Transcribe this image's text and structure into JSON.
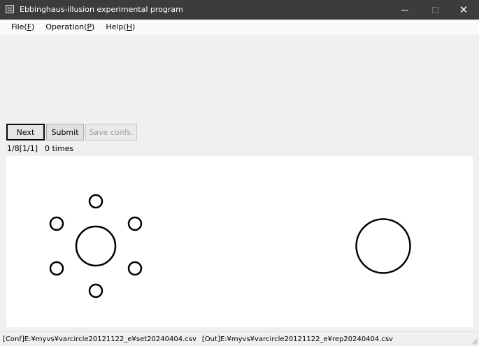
{
  "window": {
    "title": "Ebbinghaus-illusion experimental program",
    "icon": "app-grid-icon",
    "controls": {
      "minimize": "minimize-icon",
      "maximize": "maximize-icon",
      "close": "✕"
    }
  },
  "menubar": {
    "items": [
      {
        "text": "File(",
        "accel": "F",
        "end": ")"
      },
      {
        "text": "Operation(",
        "accel": "P",
        "end": ")"
      },
      {
        "text": "Help(",
        "accel": "H",
        "end": ")"
      }
    ]
  },
  "toolbar": {
    "next_label": "Next",
    "submit_label": "Submit",
    "save_label": "Save confs."
  },
  "status": {
    "progress": "1/8[1/1]",
    "count": "0 times"
  },
  "canvas": {
    "stroke_color": "#000000",
    "background": "#ffffff"
  },
  "statusbar": {
    "conf": "[Conf]E:¥myvs¥varcircle20121122_e¥set20240404.csv",
    "out": "[Out]E:¥myvs¥varcircle20121122_e¥rep20240404.csv"
  }
}
